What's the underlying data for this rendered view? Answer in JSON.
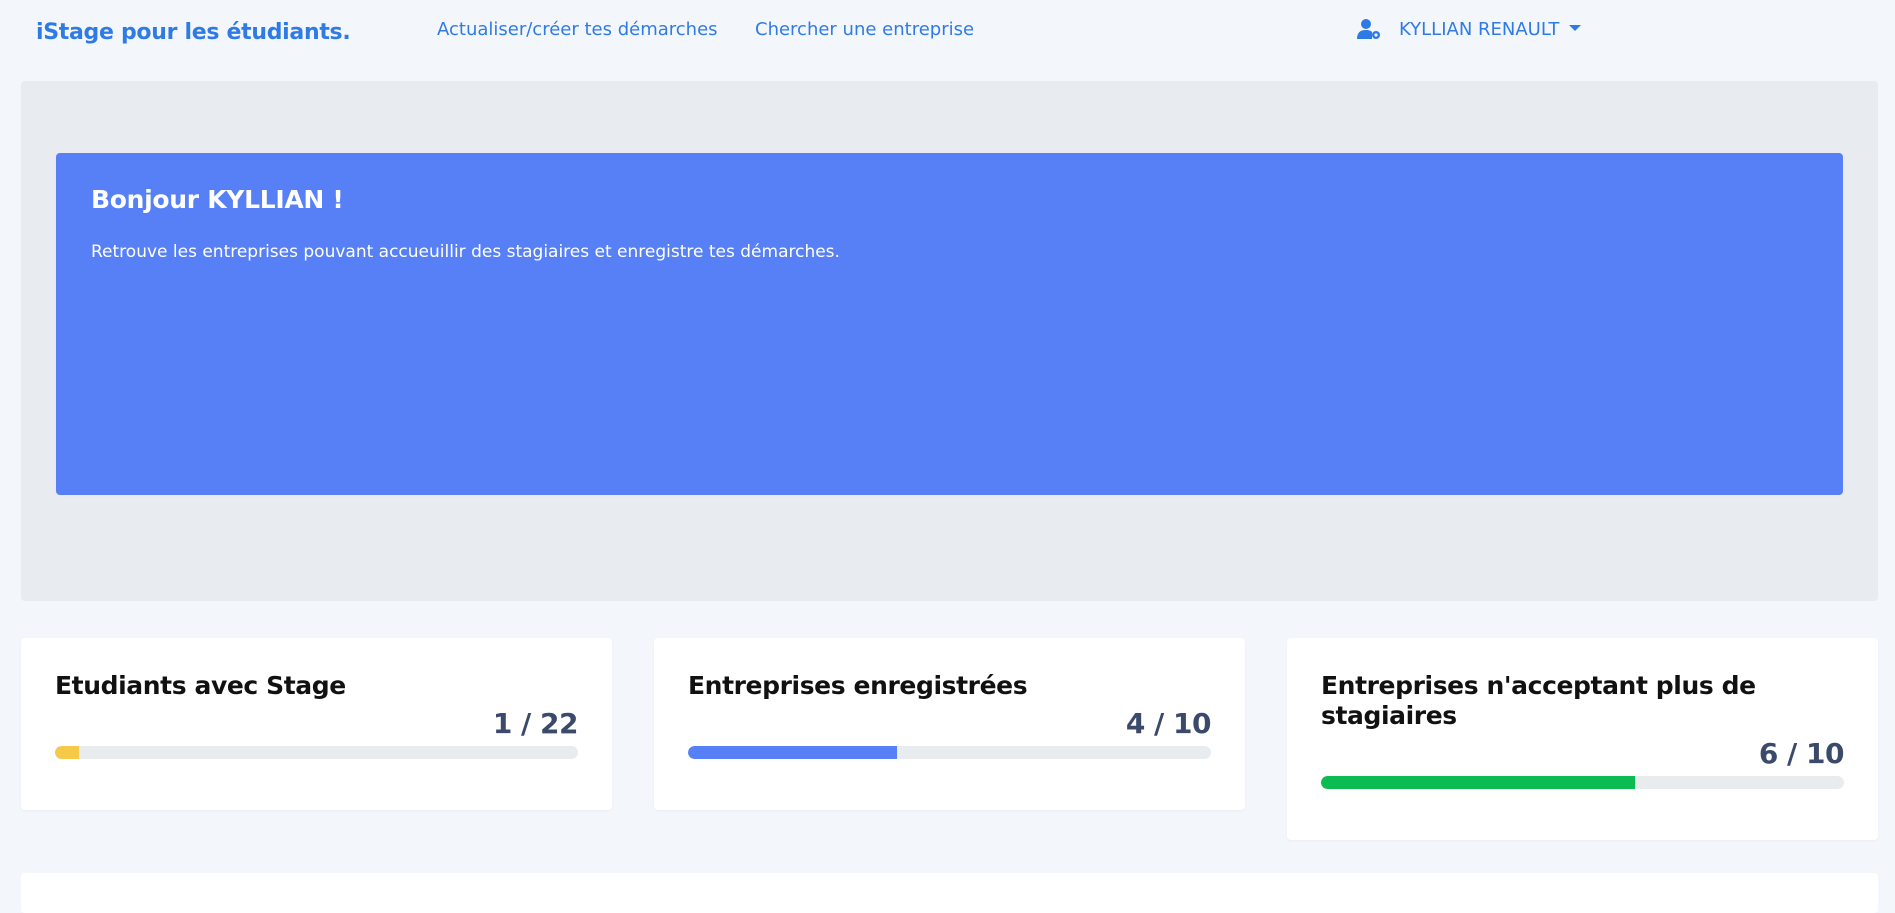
{
  "navbar": {
    "brand": "iStage pour les étudiants.",
    "links": [
      {
        "label": "Actualiser/créer tes démarches"
      },
      {
        "label": "Chercher une entreprise"
      }
    ],
    "user": {
      "name": "KYLLIAN RENAULT",
      "icon": "user-cog-icon"
    }
  },
  "hero": {
    "title": "Bonjour KYLLIAN !",
    "subtitle": "Retrouve les entreprises pouvant accueuillir des stagiaires et enregistre tes démarches."
  },
  "stats": [
    {
      "title": "Etudiants avec Stage",
      "count": "1 / 22",
      "progress": 0.045,
      "color": "#f7c948"
    },
    {
      "title": "Entreprises enregistrées",
      "count": "4 / 10",
      "progress": 0.4,
      "color": "#5780f6"
    },
    {
      "title": "Entreprises n'acceptant plus de stagiaires",
      "count": "6 / 10",
      "progress": 0.6,
      "color": "#0cbc52"
    }
  ],
  "colors": {
    "accent": "#2f7be6",
    "hero": "#5780f6",
    "page_bg": "#f3f6fb"
  }
}
